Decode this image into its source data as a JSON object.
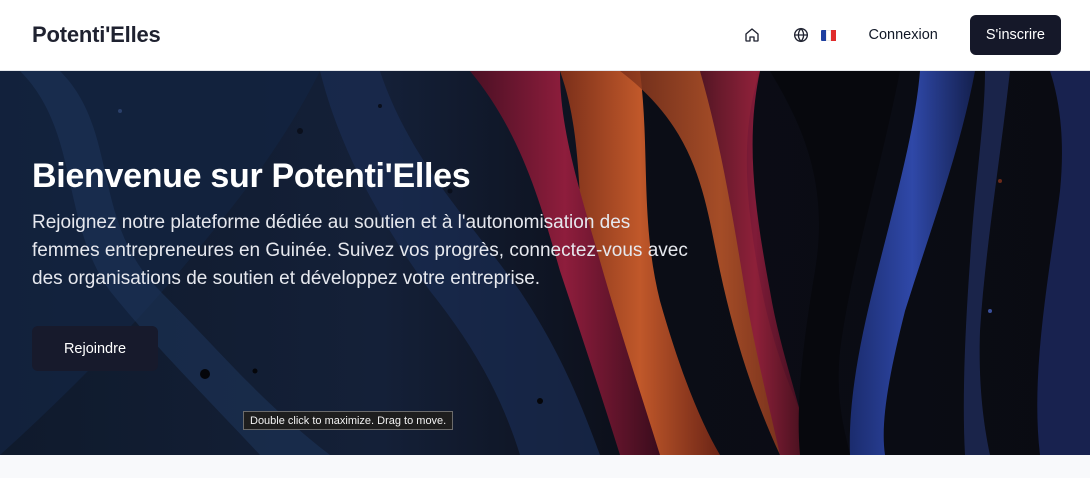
{
  "header": {
    "brand": "Potenti'Elles",
    "nav": {
      "home_icon": "home-icon",
      "language_icon": "globe-icon",
      "language_flag": "france-flag",
      "login_label": "Connexion",
      "signup_label": "S'inscrire"
    }
  },
  "hero": {
    "title": "Bienvenue sur Potenti'Elles",
    "description": "Rejoignez notre plateforme dédiée au soutien et à l'autonomisation des femmes entrepreneures en Guinée. Suivez vos progrès, connectez-vous avec des organisations de soutien et développez votre entreprise.",
    "cta_label": "Rejoindre"
  },
  "tooltip": {
    "text": "Double click to maximize. Drag to move."
  },
  "colors": {
    "primary_dark": "#151829",
    "flag_blue": "#1e3fa0",
    "flag_white": "#ffffff",
    "flag_red": "#e02b2b"
  }
}
